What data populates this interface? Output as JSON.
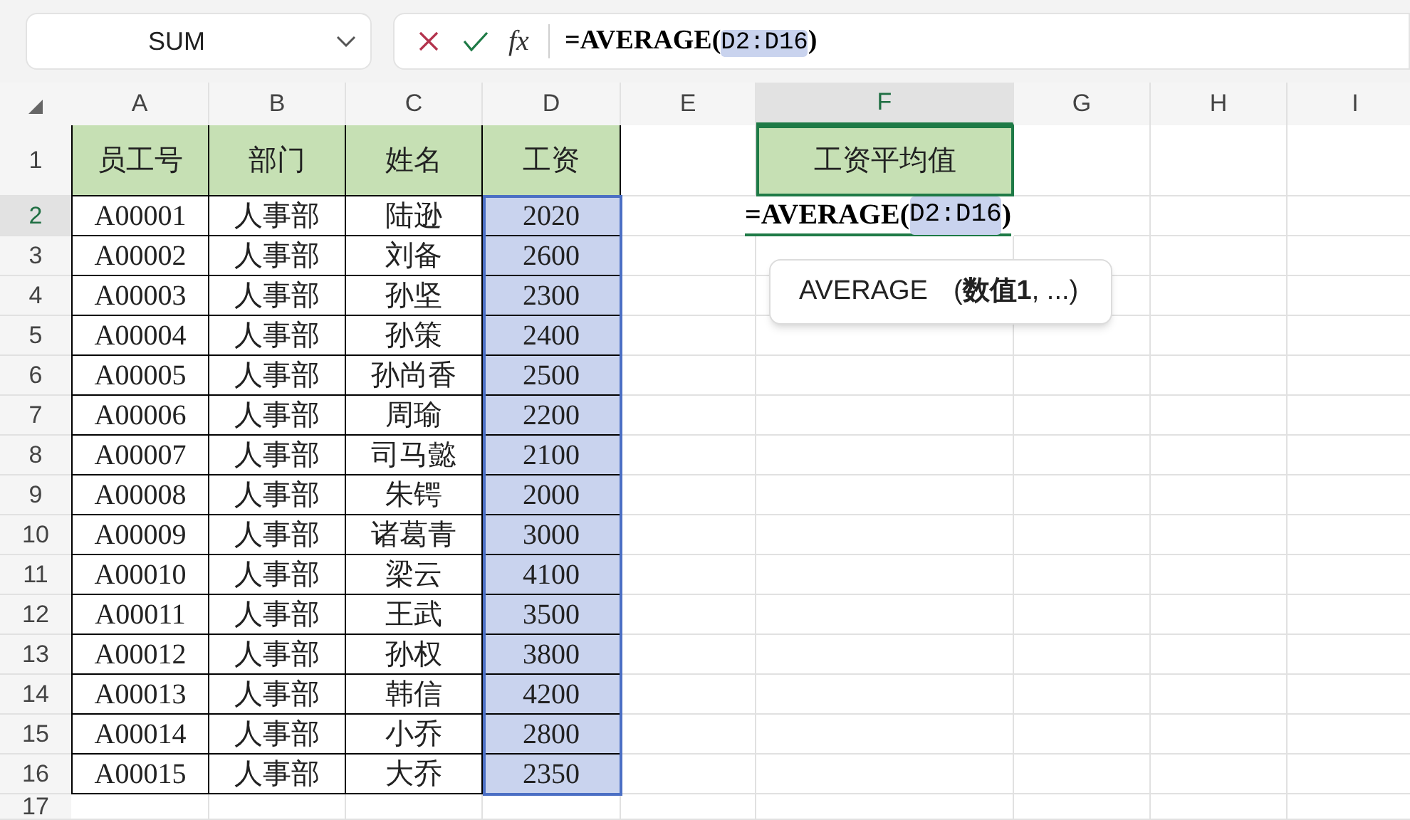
{
  "name_box": {
    "value": "SUM"
  },
  "formula_bar": {
    "fx": "fx",
    "prefix": "=AVERAGE(",
    "ref": "D2:D16",
    "suffix": ")"
  },
  "columns": [
    {
      "label": "A",
      "selected": false,
      "referenced": false
    },
    {
      "label": "B",
      "selected": false,
      "referenced": false
    },
    {
      "label": "C",
      "selected": false,
      "referenced": false
    },
    {
      "label": "D",
      "selected": false,
      "referenced": true
    },
    {
      "label": "E",
      "selected": false,
      "referenced": false
    },
    {
      "label": "F",
      "selected": true,
      "referenced": false
    },
    {
      "label": "G",
      "selected": false,
      "referenced": false
    },
    {
      "label": "H",
      "selected": false,
      "referenced": false
    },
    {
      "label": "I",
      "selected": false,
      "referenced": false
    }
  ],
  "header_row": {
    "number": "1",
    "selected": false,
    "cells": [
      "员工号",
      "部门",
      "姓名",
      "工资"
    ],
    "summary_label": "工资平均值"
  },
  "editing_cell": {
    "prefix": "=AVERAGE(",
    "ref": "D2:D16",
    "suffix": ")"
  },
  "tooltip": {
    "name": "AVERAGE",
    "args": "(**数值1**, ...)"
  },
  "rows": [
    {
      "number": "2",
      "selected": true,
      "cells": [
        "A00001",
        "人事部",
        "陆逊",
        "2020"
      ]
    },
    {
      "number": "3",
      "selected": false,
      "cells": [
        "A00002",
        "人事部",
        "刘备",
        "2600"
      ]
    },
    {
      "number": "4",
      "selected": false,
      "cells": [
        "A00003",
        "人事部",
        "孙坚",
        "2300"
      ]
    },
    {
      "number": "5",
      "selected": false,
      "cells": [
        "A00004",
        "人事部",
        "孙策",
        "2400"
      ]
    },
    {
      "number": "6",
      "selected": false,
      "cells": [
        "A00005",
        "人事部",
        "孙尚香",
        "2500"
      ]
    },
    {
      "number": "7",
      "selected": false,
      "cells": [
        "A00006",
        "人事部",
        "周瑜",
        "2200"
      ]
    },
    {
      "number": "8",
      "selected": false,
      "cells": [
        "A00007",
        "人事部",
        "司马懿",
        "2100"
      ]
    },
    {
      "number": "9",
      "selected": false,
      "cells": [
        "A00008",
        "人事部",
        "朱锷",
        "2000"
      ]
    },
    {
      "number": "10",
      "selected": false,
      "cells": [
        "A00009",
        "人事部",
        "诸葛青",
        "3000"
      ]
    },
    {
      "number": "11",
      "selected": false,
      "cells": [
        "A00010",
        "人事部",
        "梁云",
        "4100"
      ]
    },
    {
      "number": "12",
      "selected": false,
      "cells": [
        "A00011",
        "人事部",
        "王武",
        "3500"
      ]
    },
    {
      "number": "13",
      "selected": false,
      "cells": [
        "A00012",
        "人事部",
        "孙权",
        "3800"
      ]
    },
    {
      "number": "14",
      "selected": false,
      "cells": [
        "A00013",
        "人事部",
        "韩信",
        "4200"
      ]
    },
    {
      "number": "15",
      "selected": false,
      "cells": [
        "A00014",
        "人事部",
        "小乔",
        "2800"
      ]
    },
    {
      "number": "16",
      "selected": false,
      "cells": [
        "A00015",
        "人事部",
        "大乔",
        "2350"
      ]
    },
    {
      "number": "17",
      "selected": false,
      "cells": []
    }
  ]
}
